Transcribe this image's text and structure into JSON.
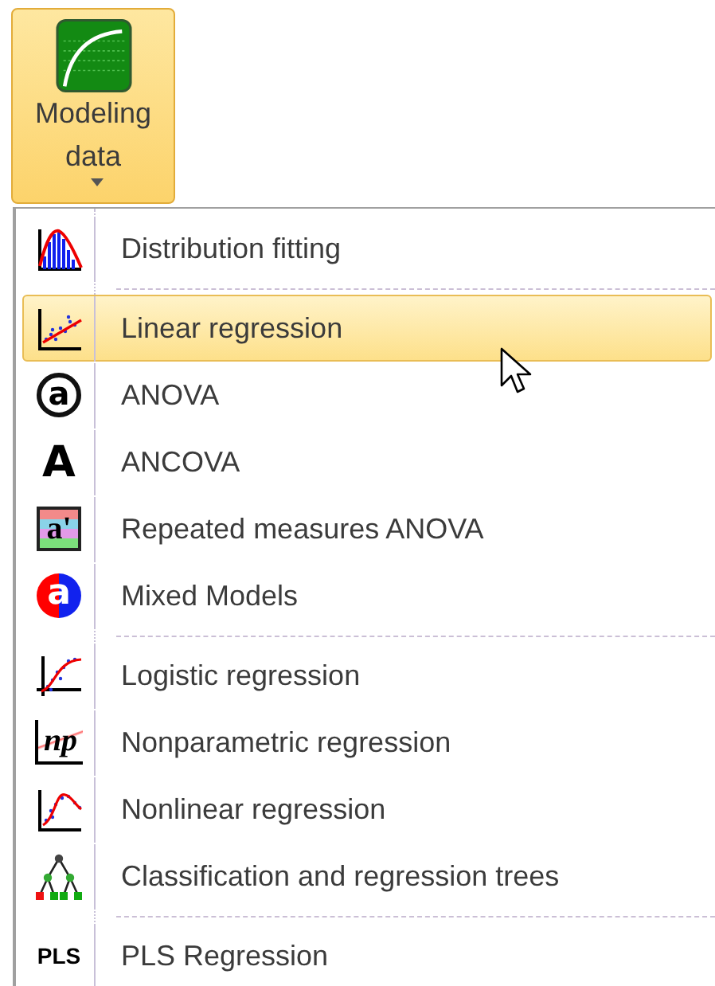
{
  "ribbon_button": {
    "label": "Modeling data",
    "highlighted": true
  },
  "menu": {
    "groups": [
      [
        {
          "label": "Distribution fitting",
          "kind": "histogram",
          "selected": false
        }
      ],
      [
        {
          "label": "Linear regression",
          "kind": "linear",
          "selected": true
        },
        {
          "label": "ANOVA",
          "kind": "circled",
          "icon_text": "a",
          "selected": false
        },
        {
          "label": "ANCOVA",
          "kind": "letter",
          "icon_text": "A",
          "selected": false
        },
        {
          "label": "Repeated measures ANOVA",
          "kind": "striped",
          "icon_text": "a'",
          "selected": false
        },
        {
          "label": "Mixed Models",
          "kind": "split",
          "icon_text": "a",
          "selected": false
        }
      ],
      [
        {
          "label": "Logistic regression",
          "kind": "logistic",
          "selected": false
        },
        {
          "label": "Nonparametric regression",
          "kind": "np",
          "icon_text": "np",
          "selected": false
        },
        {
          "label": "Nonlinear regression",
          "kind": "nonlinear",
          "selected": false
        },
        {
          "label": "Classification and regression trees",
          "kind": "tree",
          "selected": false
        }
      ],
      [
        {
          "label": "PLS Regression",
          "kind": "text",
          "icon_text": "PLS",
          "selected": false
        }
      ]
    ]
  }
}
